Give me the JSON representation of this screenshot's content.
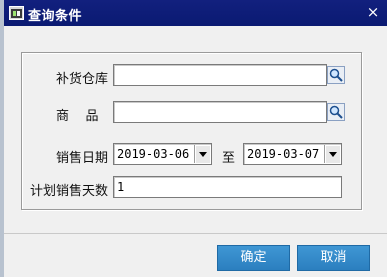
{
  "window": {
    "title": "查询条件",
    "close_glyph": "×"
  },
  "form": {
    "warehouse": {
      "label": "补货仓库",
      "value": ""
    },
    "product": {
      "label": "商    品",
      "value": ""
    },
    "date_range": {
      "label": "销售日期",
      "from": "2019-03-06",
      "separator": "至",
      "to": "2019-03-07"
    },
    "days": {
      "label": "计划销售天数",
      "value": "1"
    }
  },
  "buttons": {
    "ok": "确定",
    "cancel": "取消"
  },
  "colors": {
    "titlebar": "#0a1a72",
    "button": "#2b7fbf"
  },
  "icons": {
    "title": "app-window-icon",
    "search": "magnifier-icon",
    "dropdown": "chevron-down-icon"
  }
}
